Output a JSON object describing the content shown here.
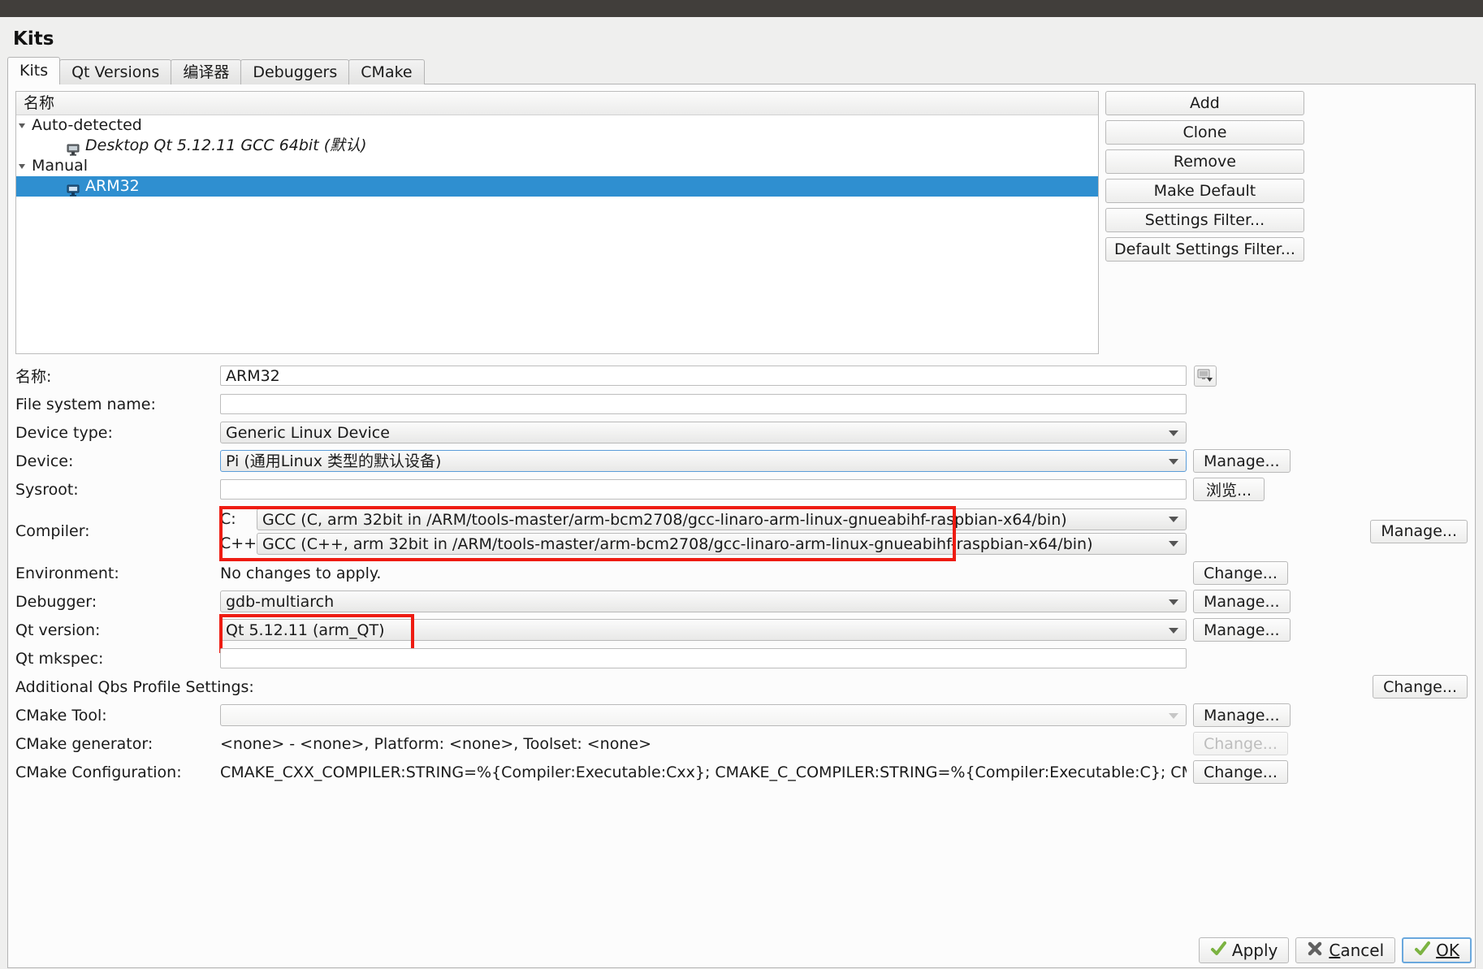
{
  "window": {
    "title": "Kits"
  },
  "tabs": [
    {
      "label": "Kits",
      "active": true
    },
    {
      "label": "Qt Versions",
      "active": false
    },
    {
      "label": "编译器",
      "active": false
    },
    {
      "label": "Debuggers",
      "active": false
    },
    {
      "label": "CMake",
      "active": false
    }
  ],
  "kit_list": {
    "column_header": "名称",
    "rows": [
      {
        "type": "group",
        "label": "Auto-detected",
        "expanded": true
      },
      {
        "type": "kit",
        "label": "Desktop Qt 5.12.11 GCC 64bit (默认)",
        "selected": false
      },
      {
        "type": "group",
        "label": "Manual",
        "expanded": true
      },
      {
        "type": "kit",
        "label": "ARM32",
        "selected": true
      }
    ]
  },
  "list_buttons": [
    {
      "label": "Add",
      "enabled": true
    },
    {
      "label": "Clone",
      "enabled": true
    },
    {
      "label": "Remove",
      "enabled": true
    },
    {
      "label": "Make Default",
      "enabled": true
    },
    {
      "label": "Settings Filter...",
      "enabled": true
    },
    {
      "label": "Default Settings Filter...",
      "enabled": true
    }
  ],
  "form": {
    "name": {
      "label": "名称:",
      "value": "ARM32",
      "icon_button": "kit-icon-picker"
    },
    "file_system_name": {
      "label": "File system name:",
      "value": ""
    },
    "device_type": {
      "label": "Device type:",
      "value": "Generic Linux Device"
    },
    "device": {
      "label": "Device:",
      "value": "Pi (通用Linux 类型的默认设备)",
      "button": "Manage..."
    },
    "sysroot": {
      "label": "Sysroot:",
      "value": "",
      "button": "浏览..."
    },
    "compiler": {
      "label": "Compiler:",
      "c_label": "C:",
      "c_value": "GCC (C, arm 32bit in /ARM/tools-master/arm-bcm2708/gcc-linaro-arm-linux-gnueabihf-raspbian-x64/bin)",
      "cxx_label": "C++:",
      "cxx_value": "GCC (C++, arm 32bit in /ARM/tools-master/arm-bcm2708/gcc-linaro-arm-linux-gnueabihf-raspbian-x64/bin)",
      "button": "Manage...",
      "highlight_color": "#ee1c12"
    },
    "environment": {
      "label": "Environment:",
      "value": "No changes to apply.",
      "button": "Change..."
    },
    "debugger": {
      "label": "Debugger:",
      "value": "gdb-multiarch",
      "button": "Manage..."
    },
    "qt_version": {
      "label": "Qt version:",
      "value": "Qt 5.12.11 (arm_QT)",
      "button": "Manage...",
      "highlight_color": "#ee1c12"
    },
    "qt_mkspec": {
      "label": "Qt mkspec:",
      "value": ""
    },
    "qbs_profile": {
      "label": "Additional Qbs Profile Settings:",
      "value": "",
      "button": "Change..."
    },
    "cmake_tool": {
      "label": "CMake Tool:",
      "value": "",
      "button": "Manage..."
    },
    "cmake_generator": {
      "label": "CMake generator:",
      "value": "<none> - <none>, Platform: <none>, Toolset: <none>",
      "button": "Change...",
      "button_enabled": false
    },
    "cmake_configuration": {
      "label": "CMake Configuration:",
      "value": "CMAKE_CXX_COMPILER:STRING=%{Compiler:Executable:Cxx}; CMAKE_C_COMPILER:STRING=%{Compiler:Executable:C}; CMAKE_PREFIX_PATH:STRIN...",
      "button": "Change..."
    }
  },
  "dialog_buttons": {
    "apply": {
      "label": "Apply",
      "icon": "check-icon"
    },
    "cancel": {
      "label": "Cancel",
      "icon": "cross-icon"
    },
    "ok": {
      "label": "OK",
      "icon": "check-icon",
      "default": true
    }
  }
}
